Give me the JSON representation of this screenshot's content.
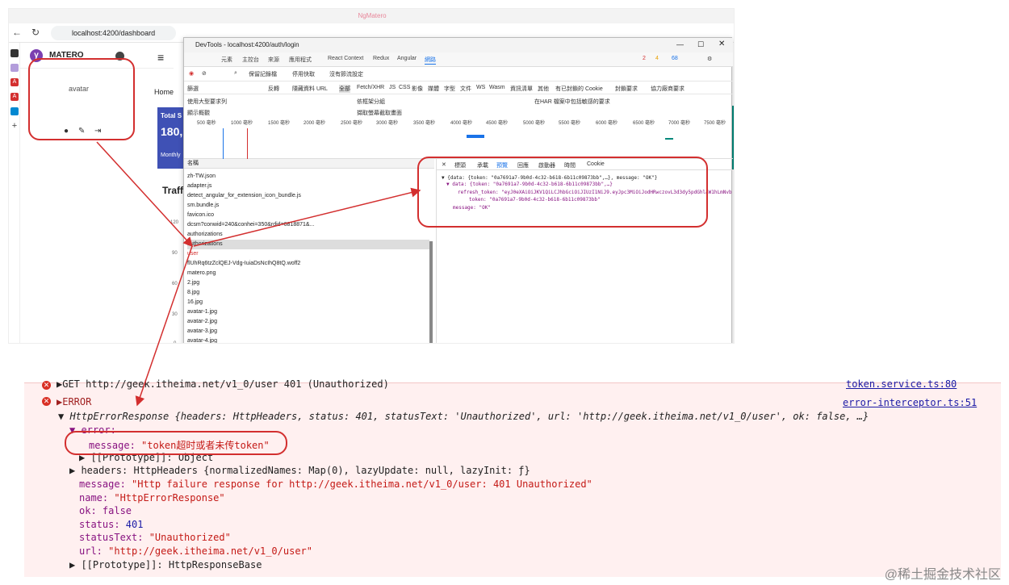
{
  "browser": {
    "window_title": "NgMatero",
    "url": "localhost:4200/dashboard"
  },
  "app": {
    "name": "MATERO",
    "avatar_alt": "avatar",
    "breadcrumb": "Home",
    "card_title": "Total S",
    "card_value": "180,",
    "card_sub": "Monthly",
    "traffic_title": "Traff",
    "y_ticks": [
      "120",
      "90",
      "60",
      "30",
      "0"
    ]
  },
  "devtools": {
    "title": "DevTools - localhost:4200/auth/login",
    "tabs": [
      "元素",
      "主控台",
      "來源",
      "應用程式",
      "React Context",
      "Redux",
      "Angular",
      "網路"
    ],
    "badges": {
      "errors": "2",
      "warnings": "4",
      "info": "68"
    },
    "net_options": [
      "保留記錄檔",
      "停用快取",
      "沒有節流設定"
    ],
    "filter_label": "篩選",
    "filter_options": [
      "反轉",
      "隱藏資料 URL",
      "全部",
      "Fetch/XHR",
      "JS",
      "CSS",
      "影像",
      "媒體",
      "字型",
      "文件",
      "WS",
      "Wasm",
      "資訊清單",
      "其他",
      "有已封鎖的 Cookie",
      "封鎖要求",
      "協力廠商要求"
    ],
    "check_options": [
      "使用大型要求列",
      "顯示概觀",
      "依框架分組",
      "擷取螢幕截取畫面",
      "在HAR 檔案中包括敏感的要求"
    ],
    "timeline": [
      "500 毫秒",
      "1000 毫秒",
      "1500 毫秒",
      "2000 毫秒",
      "2500 毫秒",
      "3000 毫秒",
      "3500 毫秒",
      "4000 毫秒",
      "4500 毫秒",
      "5000 毫秒",
      "5500 毫秒",
      "6000 毫秒",
      "6500 毫秒",
      "7000 毫秒",
      "7500 毫秒"
    ],
    "name_header": "名稱",
    "files": [
      "zh-TW.json",
      "adapter.js",
      "detect_angular_for_extension_icon_bundle.js",
      "sm.bundle.js",
      "favicon.ico",
      "dcsm?conwid=240&conhei=350&rdid=6818871&...",
      "authorizations",
      "authorizations",
      "user",
      "flUhRq6tzZclQEJ-Vdg-IuiaDsNcIhQ8tQ.woff2",
      "matero.png",
      "2.jpg",
      "8.jpg",
      "16.jpg",
      "avatar-1.jpg",
      "avatar-2.jpg",
      "avatar-3.jpg",
      "avatar-4.jpg"
    ],
    "preview_tabs": [
      "標頭",
      "承載",
      "預覽",
      "回應",
      "啟動器",
      "時間",
      "Cookie"
    ],
    "json_lines": [
      "▼ {data: {token: \"0a7691a7-9b0d-4c32-b618-6b11c09873bb\",…}, message: \"OK\"}",
      "▼ data: {token: \"0a7691a7-9b0d-4c32-b618-6b11c09873bb\",…}",
      "refresh_token: \"eyJ0eXAiOiJKV1QiLCJhbGciOiJIUzI1NiJ9.eyJpc3MiOiJodHRwczovL3d3dy5pdGhlaW1hLmNvbSJ9",
      "token: \"0a7691a7-9b0d-4c32-b618-6b11c09873bb\"",
      "message: \"OK\""
    ]
  },
  "console": {
    "line0_text": "▶GET http://geek.itheima.net/v1_0/user 401 (Unauthorized)",
    "line0_src": "token.service.ts:80",
    "line1_text": "▶ERROR",
    "line1_src": "error-interceptor.ts:51",
    "line2": "▼ HttpErrorResponse {headers: HttpHeaders, status: 401, statusText: 'Unauthorized', url: 'http://geek.itheima.net/v1_0/user', ok: false, …}",
    "error_key": "▼ error:",
    "message_key": "message: ",
    "message_val": "\"token超时或者未传token\"",
    "proto1": "▶ [[Prototype]]: Object",
    "headers_line": "▶ headers: HttpHeaders {normalizedNames: Map(0), lazyUpdate: null, lazyInit: ƒ}",
    "message2_key": "message: ",
    "message2_val": "\"Http failure response for http://geek.itheima.net/v1_0/user: 401 Unauthorized\"",
    "name_key": "name: ",
    "name_val": "\"HttpErrorResponse\"",
    "ok_key": "ok: ",
    "ok_val": "false",
    "status_key": "status: ",
    "status_val": "401",
    "statusText_key": "statusText: ",
    "statusText_val": "\"Unauthorized\"",
    "url_key": "url: ",
    "url_val": "\"http://geek.itheima.net/v1_0/user\"",
    "proto2": "▶ [[Prototype]]: HttpResponseBase"
  },
  "watermark": "@稀土掘金技术社区"
}
